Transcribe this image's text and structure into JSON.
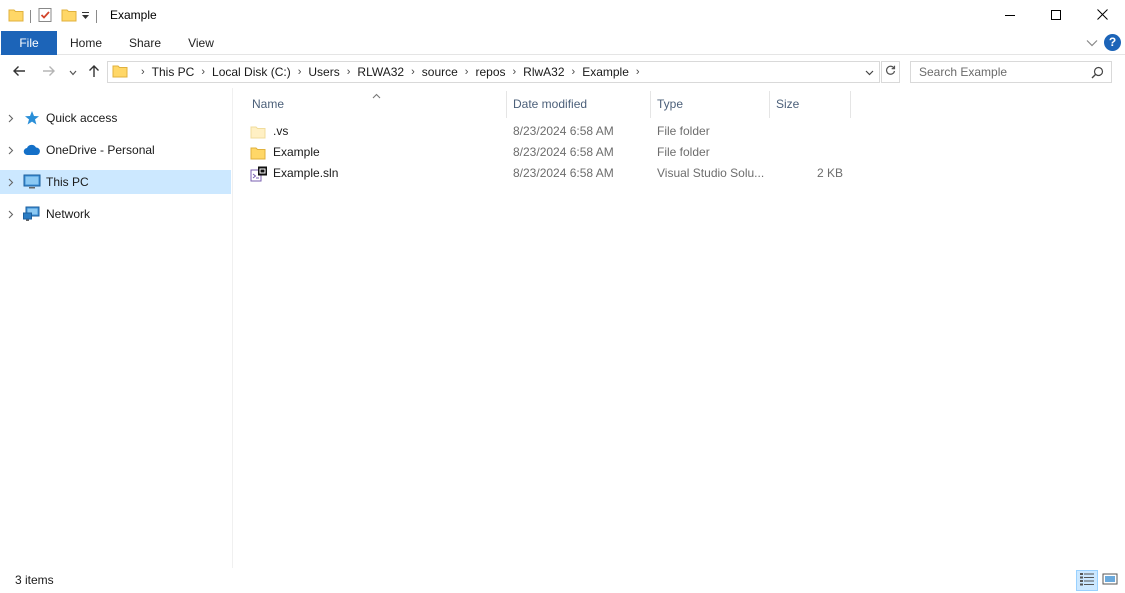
{
  "window": {
    "title": "Example",
    "minimize_icon": "minimize-icon",
    "maximize_icon": "maximize-icon",
    "close_icon": "close-icon"
  },
  "quick_access_toolbar": {
    "icons": [
      "folder-icon",
      "properties-icon",
      "new-folder-icon",
      "customize-dropdown-icon"
    ]
  },
  "ribbon": {
    "tabs": [
      {
        "label": "File"
      },
      {
        "label": "Home"
      },
      {
        "label": "Share"
      },
      {
        "label": "View"
      }
    ],
    "accent_color": "#1c64b8",
    "help_label": "?"
  },
  "address_bar": {
    "breadcrumbs": [
      "This PC",
      "Local Disk (C:)",
      "Users",
      "RLWA32",
      "source",
      "repos",
      "RlwA32",
      "Example"
    ]
  },
  "search": {
    "placeholder": "Search Example"
  },
  "nav_pane": {
    "items": [
      {
        "label": "Quick access",
        "icon": "star-icon",
        "selected": false
      },
      {
        "label": "OneDrive - Personal",
        "icon": "cloud-icon",
        "selected": false
      },
      {
        "label": "This PC",
        "icon": "computer-icon",
        "selected": true
      },
      {
        "label": "Network",
        "icon": "network-icon",
        "selected": false
      }
    ],
    "selected_color": "#cce8ff"
  },
  "file_list": {
    "columns": [
      "Name",
      "Date modified",
      "Type",
      "Size"
    ],
    "sort_column": "Name",
    "rows": [
      {
        "name": ".vs",
        "date": "8/23/2024 6:58 AM",
        "type": "File folder",
        "size": "",
        "icon": "hidden-folder-icon"
      },
      {
        "name": "Example",
        "date": "8/23/2024 6:58 AM",
        "type": "File folder",
        "size": "",
        "icon": "folder-icon"
      },
      {
        "name": "Example.sln",
        "date": "8/23/2024 6:58 AM",
        "type": "Visual Studio Solu...",
        "size": "2 KB",
        "icon": "visual-studio-solution-icon"
      }
    ]
  },
  "status_bar": {
    "item_count": "3 items",
    "views": [
      "details-view",
      "large-icons-view"
    ],
    "active_view": "details-view"
  }
}
